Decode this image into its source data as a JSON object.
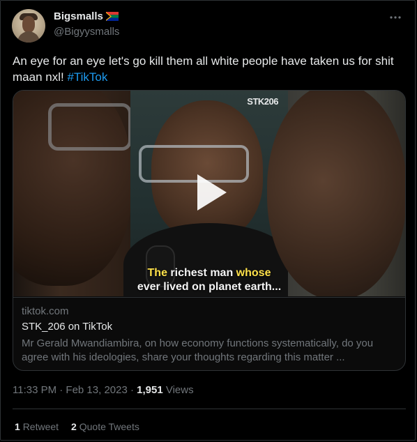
{
  "author": {
    "display_name": "Bigsmalls",
    "handle": "@Bigyysmalls",
    "flag_icon": "south-africa-flag-icon"
  },
  "more_icon": "more-horizontal-icon",
  "tweet": {
    "text": "An eye for an eye let's go kill them all white people have taken us for shit maan nxl! ",
    "hashtag": "#TikTok"
  },
  "media": {
    "watermark": "STK206",
    "caption_part1": "The",
    "caption_part2": " richest man ",
    "caption_part3": "whose",
    "caption_line2": "ever lived on planet earth...",
    "play_icon": "play-icon"
  },
  "link_card": {
    "domain": "tiktok.com",
    "title": "STK_206 on TikTok",
    "description": "Mr Gerald Mwandiambira, on how economy functions systematically, do you agree with his ideologies, share your thoughts regarding this matter ..."
  },
  "meta": {
    "time": "11:33 PM · Feb 13, 2023 · ",
    "views_count": "1,951",
    "views_label": " Views"
  },
  "stats": {
    "retweets_count": "1",
    "retweets_label": "Retweet",
    "quotes_count": "2",
    "quotes_label": "Quote Tweets"
  },
  "colors": {
    "background": "#000000",
    "text": "#e7e9ea",
    "muted": "#71767b",
    "link": "#1d9bf0",
    "border": "#2f3336",
    "caption_highlight": "#ffe14a"
  }
}
